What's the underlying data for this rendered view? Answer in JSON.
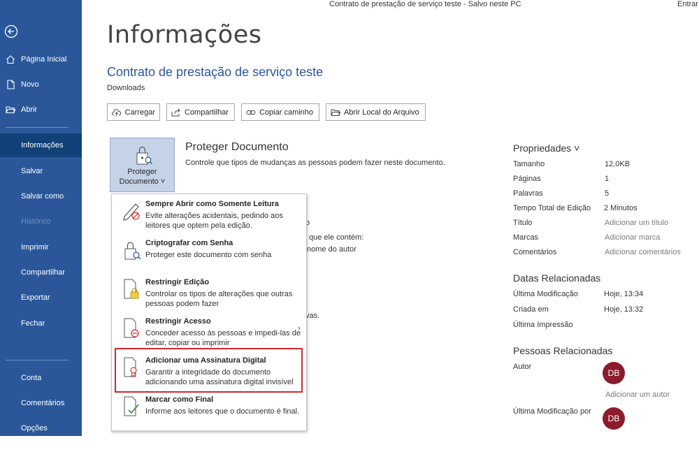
{
  "titlebar": {
    "doc_title": "Contrato de prestação de serviço teste  -  Salvo neste PC",
    "signin": "Entrar"
  },
  "sidebar": {
    "items": [
      {
        "label": "Página Inicial"
      },
      {
        "label": "Novo"
      },
      {
        "label": "Abrir"
      },
      {
        "label": "Informações"
      },
      {
        "label": "Salvar"
      },
      {
        "label": "Salvar como"
      },
      {
        "label": "Histórico"
      },
      {
        "label": "Imprimir"
      },
      {
        "label": "Compartilhar"
      },
      {
        "label": "Exportar"
      },
      {
        "label": "Fechar"
      },
      {
        "label": "Conta"
      },
      {
        "label": "Comentários"
      },
      {
        "label": "Opções"
      }
    ]
  },
  "header": {
    "page_title": "Informações",
    "doc_name": "Contrato de prestação de serviço teste",
    "location": "Downloads"
  },
  "toolbar": {
    "upload": "Carregar",
    "share": "Compartilhar",
    "copy_path": "Copiar caminho",
    "open_location": "Abrir Local do Arquivo"
  },
  "protect": {
    "button_line1": "Proteger",
    "button_line2": "Documento ˅",
    "heading": "Proteger Documento",
    "description": "Controle que tipos de mudanças as pessoas podem fazer neste documento."
  },
  "behind_text": {
    "t1": "o",
    "t2": "que ele contém:",
    "t3": "nome do autor",
    "t4": "vas."
  },
  "menu": {
    "items": [
      {
        "title": "Sempre Abrir como Somente Leitura",
        "desc": "Evite alterações acidentais, pedindo aos leitores que optem pela edição."
      },
      {
        "title": "Criptografar com Senha",
        "desc": "Proteger este documento com senha"
      },
      {
        "title": "Restringir Edição",
        "desc": "Controlar os tipos de alterações que outras pessoas podem fazer"
      },
      {
        "title": "Restringir Acesso",
        "desc": "Conceder acesso às pessoas e impedi-las de editar, copiar ou imprimir"
      },
      {
        "title": "Adicionar uma Assinatura Digital",
        "desc": "Garantir a integridade do documento adicionando uma assinatura digital invisível"
      },
      {
        "title": "Marcar como Final",
        "desc": "Informe aos leitores que o documento é final."
      }
    ],
    "submenu_arrow": "›"
  },
  "properties": {
    "heading": "Propriedades ˅",
    "rows": [
      {
        "label": "Tamanho",
        "value": "12,0KB"
      },
      {
        "label": "Páginas",
        "value": "1"
      },
      {
        "label": "Palavras",
        "value": "5"
      },
      {
        "label": "Tempo Total de Edição",
        "value": "2 Minutos"
      },
      {
        "label": "Título",
        "value": "Adicionar um título"
      },
      {
        "label": "Marcas",
        "value": "Adicionar marca"
      },
      {
        "label": "Comentários",
        "value": "Adicionar comentários"
      }
    ]
  },
  "related_dates": {
    "heading": "Datas Relacionadas",
    "rows": [
      {
        "label": "Última Modificação",
        "value": "Hoje, 13:34"
      },
      {
        "label": "Criada em",
        "value": "Hoje, 13:32"
      },
      {
        "label": "Última Impressão",
        "value": ""
      }
    ]
  },
  "related_people": {
    "heading": "Pessoas Relacionadas",
    "author_label": "Autor",
    "author_initials": "DB",
    "add_author": "Adicionar um autor",
    "last_modified_label": "Última Modificação por",
    "last_modified_initials": "DB"
  },
  "colors": {
    "sidebar": "#2b579a",
    "sidebar_active": "#124078",
    "accent": "#2b579a",
    "highlight": "#d0282e",
    "avatar": "#8b1c2c"
  }
}
